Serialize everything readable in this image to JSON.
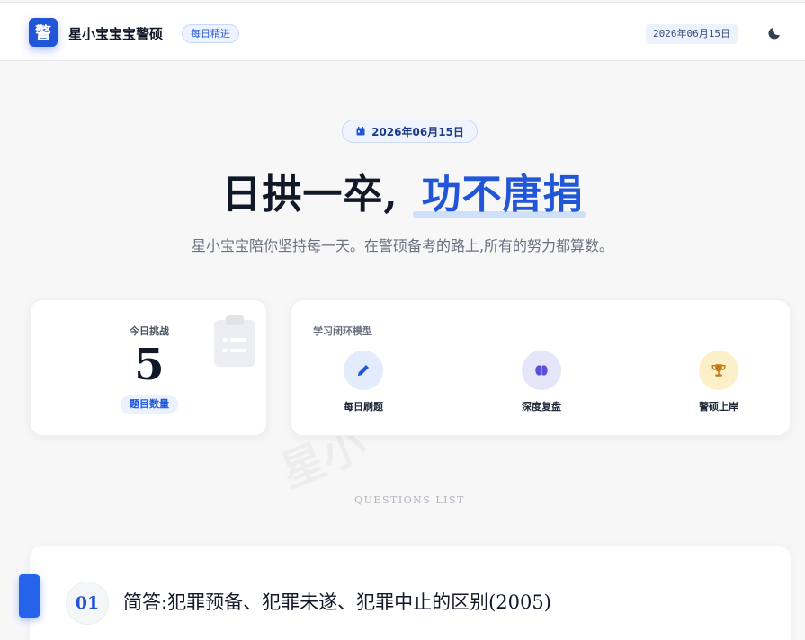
{
  "header": {
    "logo_char": "警",
    "brand": "星小宝宝宝警硕",
    "badge": "每日精进",
    "date": "2026年06月15日",
    "theme_toggle_icon": "moon-icon"
  },
  "hero": {
    "date": "2026年06月15日",
    "date_icon": "calendar-icon",
    "headline_plain": "日拱一卒,",
    "headline_accent": "功不唐捐",
    "subline": "星小宝宝陪你坚持每一天。在警硕备考的路上,所有的努力都算数。"
  },
  "challenge_card": {
    "label": "今日挑战",
    "count": "5",
    "tag": "题目数量",
    "icon": "clipboard-list-icon"
  },
  "loop_card": {
    "title": "学习闭环模型",
    "steps": [
      {
        "label": "每日刷题",
        "icon": "pencil-icon",
        "bg": "#e3ecfd",
        "color": "#2156d8"
      },
      {
        "label": "深度复盘",
        "icon": "brain-icon",
        "bg": "#e6e6fb",
        "color": "#5b4fd6"
      },
      {
        "label": "警硕上岸",
        "icon": "trophy-icon",
        "bg": "#fdf0c9",
        "color": "#c27b10"
      }
    ]
  },
  "watermark": "星小",
  "section_divider": "QUESTIONS LIST",
  "questions": [
    {
      "number": "01",
      "title": "简答:犯罪预备、犯罪未遂、犯罪中止的区别(2005)"
    }
  ],
  "colors": {
    "accent": "#2156d8",
    "background": "#f7f7f8"
  }
}
